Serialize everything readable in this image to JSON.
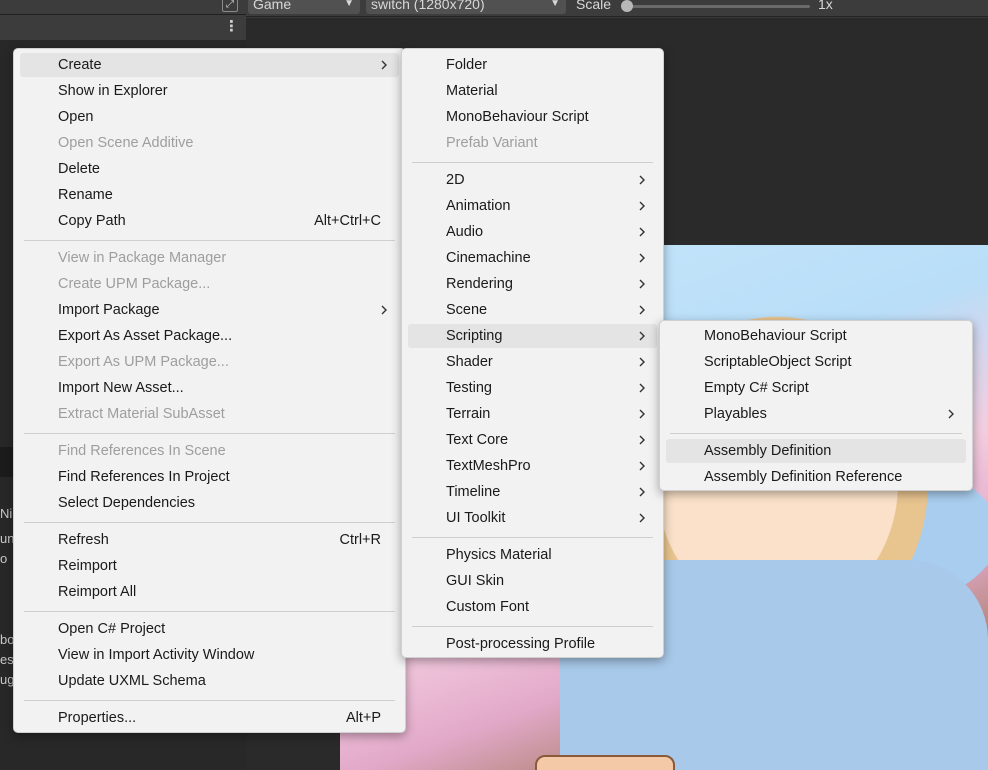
{
  "game_toolbar": {
    "view_dropdown": "Game",
    "resolution_dropdown": "switch (1280x720)",
    "scale_label": "Scale",
    "scale_value": "1x"
  },
  "side_fragments": [
    "Ni",
    "un",
    "o",
    "bo",
    "es",
    "ug"
  ],
  "context_menu": {
    "groups": [
      [
        {
          "label": "Create",
          "submenu": true,
          "highlight": true
        },
        {
          "label": "Show in Explorer"
        },
        {
          "label": "Open"
        },
        {
          "label": "Open Scene Additive",
          "disabled": true
        },
        {
          "label": "Delete"
        },
        {
          "label": "Rename"
        },
        {
          "label": "Copy Path",
          "shortcut": "Alt+Ctrl+C"
        }
      ],
      [
        {
          "label": "View in Package Manager",
          "disabled": true
        },
        {
          "label": "Create UPM Package...",
          "disabled": true
        },
        {
          "label": "Import Package",
          "submenu": true
        },
        {
          "label": "Export As Asset Package..."
        },
        {
          "label": "Export As UPM Package...",
          "disabled": true
        },
        {
          "label": "Import New Asset..."
        },
        {
          "label": "Extract Material SubAsset",
          "disabled": true
        }
      ],
      [
        {
          "label": "Find References In Scene",
          "disabled": true
        },
        {
          "label": "Find References In Project"
        },
        {
          "label": "Select Dependencies"
        }
      ],
      [
        {
          "label": "Refresh",
          "shortcut": "Ctrl+R"
        },
        {
          "label": "Reimport"
        },
        {
          "label": "Reimport All"
        }
      ],
      [
        {
          "label": "Open C# Project"
        },
        {
          "label": "View in Import Activity Window"
        },
        {
          "label": "Update UXML Schema"
        }
      ],
      [
        {
          "label": "Properties...",
          "shortcut": "Alt+P"
        }
      ]
    ]
  },
  "create_menu": {
    "groups": [
      [
        {
          "label": "Folder"
        },
        {
          "label": "Material"
        },
        {
          "label": "MonoBehaviour Script"
        },
        {
          "label": "Prefab Variant",
          "disabled": true
        }
      ],
      [
        {
          "label": "2D",
          "submenu": true
        },
        {
          "label": "Animation",
          "submenu": true
        },
        {
          "label": "Audio",
          "submenu": true
        },
        {
          "label": "Cinemachine",
          "submenu": true
        },
        {
          "label": "Rendering",
          "submenu": true
        },
        {
          "label": "Scene",
          "submenu": true
        },
        {
          "label": "Scripting",
          "submenu": true,
          "highlight": true
        },
        {
          "label": "Shader",
          "submenu": true
        },
        {
          "label": "Testing",
          "submenu": true
        },
        {
          "label": "Terrain",
          "submenu": true
        },
        {
          "label": "Text Core",
          "submenu": true
        },
        {
          "label": "TextMeshPro",
          "submenu": true
        },
        {
          "label": "Timeline",
          "submenu": true
        },
        {
          "label": "UI Toolkit",
          "submenu": true
        }
      ],
      [
        {
          "label": "Physics Material"
        },
        {
          "label": "GUI Skin"
        },
        {
          "label": "Custom Font"
        }
      ],
      [
        {
          "label": "Post-processing Profile"
        }
      ]
    ]
  },
  "scripting_menu": {
    "groups": [
      [
        {
          "label": "MonoBehaviour Script"
        },
        {
          "label": "ScriptableObject Script"
        },
        {
          "label": "Empty C# Script"
        },
        {
          "label": "Playables",
          "submenu": true
        }
      ],
      [
        {
          "label": "Assembly Definition",
          "highlight": true
        },
        {
          "label": "Assembly Definition Reference"
        }
      ]
    ]
  }
}
